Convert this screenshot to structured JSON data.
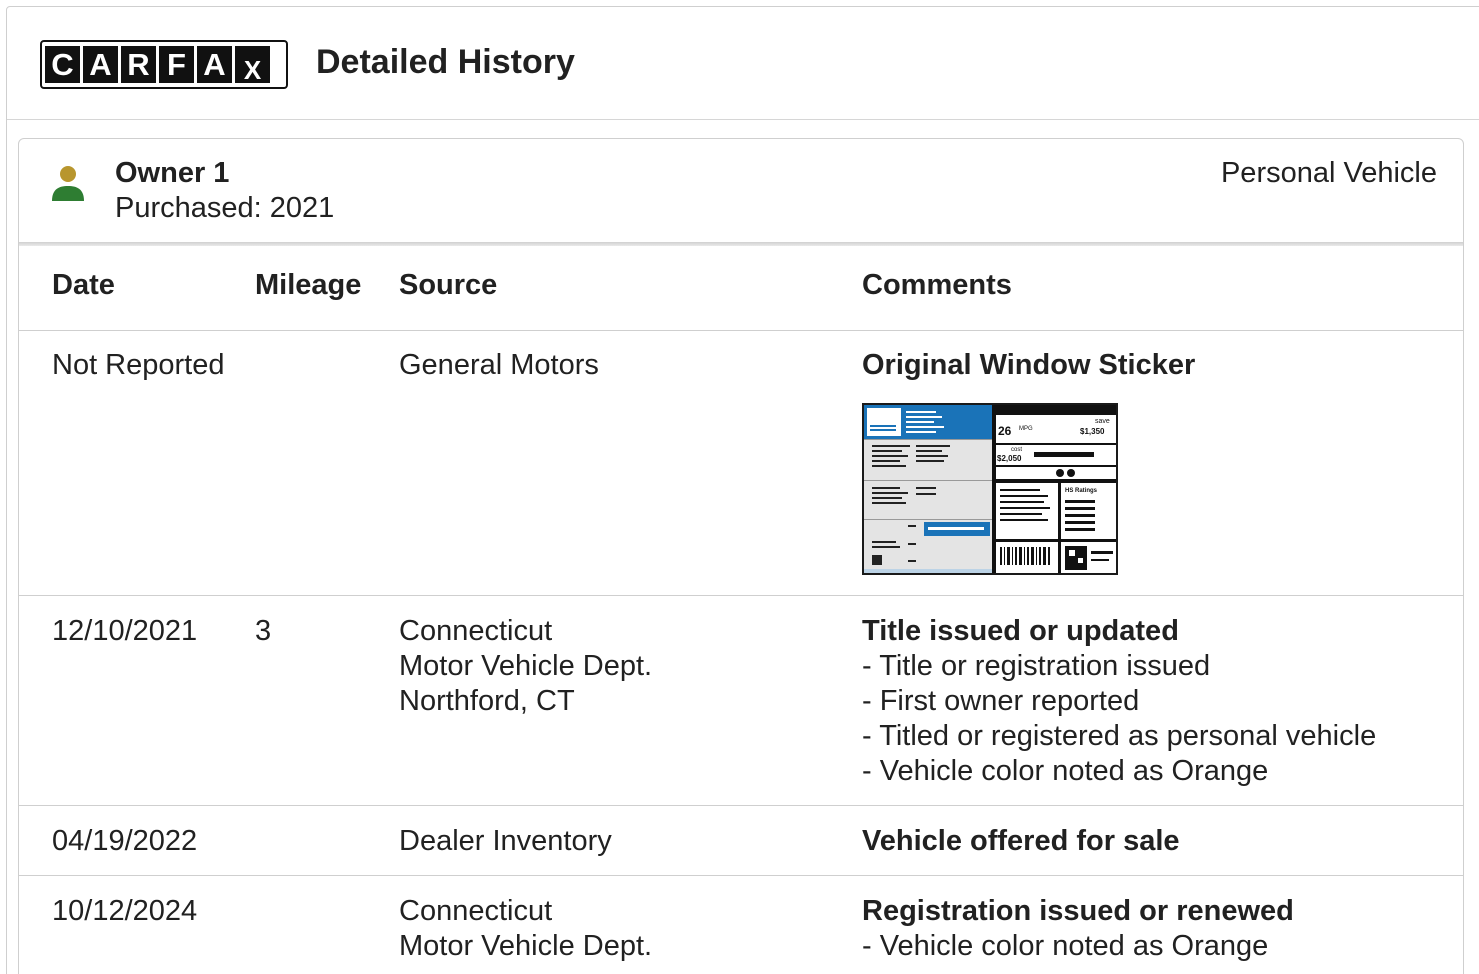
{
  "header": {
    "logo_letters": [
      "C",
      "A",
      "R",
      "F",
      "A",
      "X"
    ],
    "title": "Detailed History"
  },
  "owner": {
    "name": "Owner 1",
    "purchased": "Purchased: 2021",
    "type": "Personal Vehicle",
    "icon": "person-icon",
    "icon_colors": {
      "head": "#b8962e",
      "body": "#2e7d32"
    }
  },
  "table": {
    "headers": {
      "date": "Date",
      "mileage": "Mileage",
      "source": "Source",
      "comments": "Comments"
    },
    "rows": [
      {
        "date": "Not Reported",
        "mileage": "",
        "source": [
          "General Motors"
        ],
        "comment_title": "Original Window Sticker",
        "comment_lines": []
      },
      {
        "date": "12/10/2021",
        "mileage": "3",
        "source": [
          "Connecticut",
          "Motor Vehicle Dept.",
          "Northford, CT"
        ],
        "comment_title": "Title issued or updated",
        "comment_lines": [
          "- Title or registration issued",
          "- First owner reported",
          "- Titled or registered as personal vehicle",
          "- Vehicle color noted as Orange"
        ]
      },
      {
        "date": "04/19/2022",
        "mileage": "",
        "source": [
          "Dealer Inventory"
        ],
        "comment_title": "Vehicle offered for sale",
        "comment_lines": []
      },
      {
        "date": "10/12/2024",
        "mileage": "",
        "source": [
          "Connecticut",
          "Motor Vehicle Dept."
        ],
        "comment_title": "Registration issued or renewed",
        "comment_lines": [
          "- Vehicle color noted as Orange"
        ]
      }
    ]
  },
  "sticker": {
    "fuel_value": "26",
    "fuel_unit": "MPG",
    "you_save_label": "save",
    "you_save_value": "$1,350",
    "annual_cost_label": "cost",
    "annual_cost_value": "$2,050",
    "ratings_label": "HS Ratings",
    "accent_color": "#1a73b8"
  }
}
